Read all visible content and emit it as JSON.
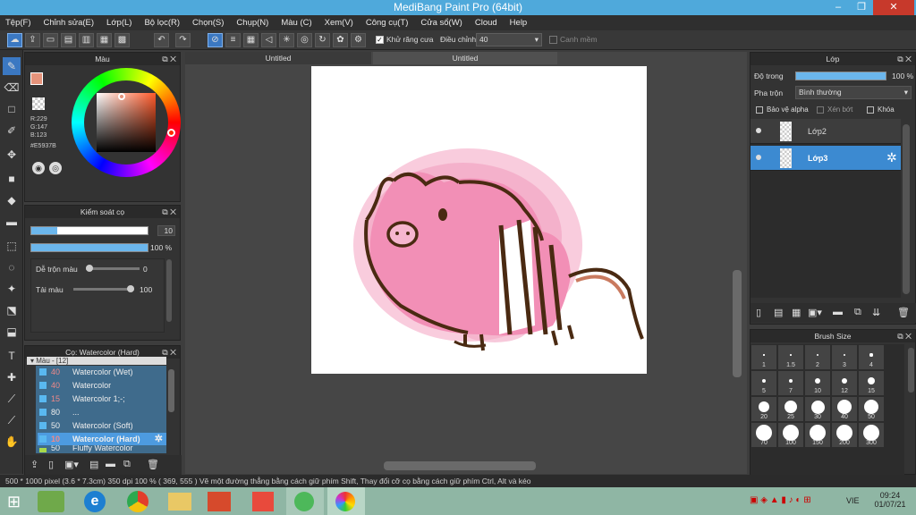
{
  "window": {
    "title": "MediBang Paint Pro (64bit)",
    "min": "‒",
    "max": "❐",
    "close": "✕"
  },
  "menu": [
    "Tệp(F)",
    "Chỉnh sửa(E)",
    "Lớp(L)",
    "Bộ lọc(R)",
    "Chọn(S)",
    "Chụp(N)",
    "Màu (C)",
    "Xem(V)",
    "Công cụ(T)",
    "Cửa sổ(W)",
    "Cloud",
    "Help"
  ],
  "toolbar": {
    "antialias_label": "Khử răng cưa",
    "adjust_label": "Điều chỉnh",
    "adjust_value": "40",
    "smooth_label": "Canh mềm"
  },
  "color_panel": {
    "title": "Màu",
    "r": "R:229",
    "g": "G:147",
    "b": "B:123",
    "hex": "#E5937B",
    "current_color": "#e5937b"
  },
  "brush_control": {
    "title": "Kiểm soát cọ",
    "size": "10",
    "opacity": "100 %",
    "blend_label": "Dễ trộn màu",
    "blend_value": "0",
    "amount_label": "Tải màu",
    "amount_value": "100"
  },
  "brush_list": {
    "title": "Cọ: Watercolor (Hard)",
    "group": "Màu - [12]",
    "items": [
      {
        "size": "40",
        "name": "Watercolor (Wet)"
      },
      {
        "size": "40",
        "name": "Watercolor"
      },
      {
        "size": "15",
        "name": "Watercolor 1;-;"
      },
      {
        "size": "80",
        "name": "..."
      },
      {
        "size": "50",
        "name": "Watercolor (Soft)"
      },
      {
        "size": "10",
        "name": "Watercolor (Hard)"
      },
      {
        "size": "50",
        "name": "Fluffy Watercolor"
      }
    ]
  },
  "tabs": [
    "Untitled",
    "Untitled"
  ],
  "layer_panel": {
    "title": "Lớp",
    "opacity_label": "Độ trong",
    "opacity_value": "100 %",
    "blend_label": "Pha trộn",
    "blend_value": "Bình thường",
    "protect_alpha": "Bảo vệ alpha",
    "clip": "Xén bớt",
    "lock": "Khóa",
    "layers": [
      {
        "name": "Lớp2"
      },
      {
        "name": "Lớp3"
      }
    ]
  },
  "brush_size": {
    "title": "Brush Size",
    "sizes": [
      "1",
      "1.5",
      "2",
      "3",
      "4",
      "5",
      "7",
      "10",
      "12",
      "15",
      "20",
      "25",
      "30",
      "40",
      "50",
      "70",
      "100",
      "150",
      "200",
      "300"
    ]
  },
  "status": "500 * 1000 pixel   (3.6 * 7.3cm)   350 dpi   100 %   ( 369, 555 )   Vẽ một đường thẳng bằng cách giữ phím Shift, Thay đổi cỡ cọ bằng cách giữ phím Ctrl, Alt và kéo",
  "taskbar": {
    "lang": "VIE",
    "time": "09:24",
    "date": "01/07/21"
  }
}
